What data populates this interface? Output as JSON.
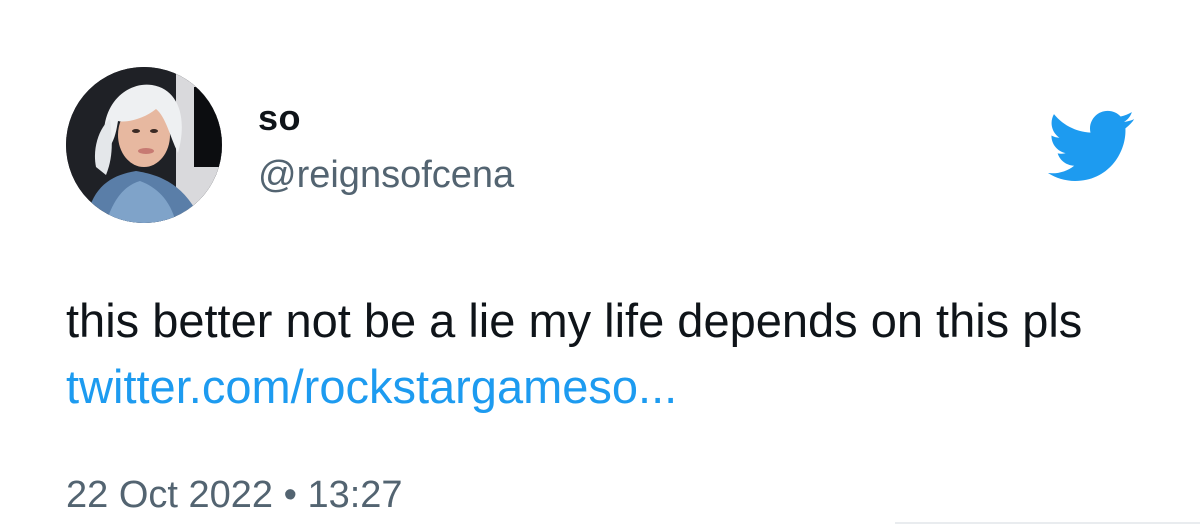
{
  "user": {
    "display_name": "so",
    "handle": "@reignsofcena",
    "avatar_icon": "profile-photo"
  },
  "tweet": {
    "text": "this better not be a lie my life depends on this pls ",
    "link_text": "twitter.com/rockstargameso...",
    "date": "22 Oct 2022",
    "separator": " • ",
    "time": "13:27"
  },
  "brand": {
    "icon": "twitter-bird-icon",
    "color": "#1d9bf0"
  },
  "colors": {
    "text": "#0f1419",
    "secondary": "#536471",
    "link": "#1d9bf0",
    "background": "#ffffff"
  }
}
